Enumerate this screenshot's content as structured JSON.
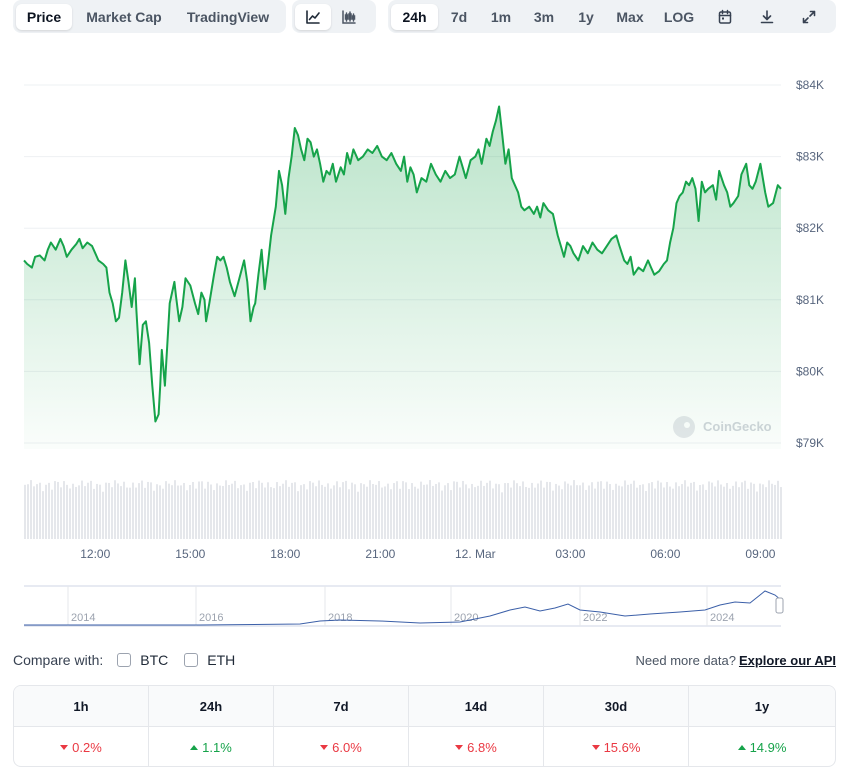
{
  "toolbar": {
    "metric_tabs": [
      {
        "label": "Price",
        "active": true
      },
      {
        "label": "Market Cap",
        "active": false
      },
      {
        "label": "TradingView",
        "active": false
      }
    ],
    "chart_type_icons": [
      {
        "name": "line-chart-icon",
        "active": true
      },
      {
        "name": "candlestick-chart-icon",
        "active": false
      }
    ],
    "ranges": [
      {
        "label": "24h",
        "active": true
      },
      {
        "label": "7d",
        "active": false
      },
      {
        "label": "1m",
        "active": false
      },
      {
        "label": "3m",
        "active": false
      },
      {
        "label": "1y",
        "active": false
      },
      {
        "label": "Max",
        "active": false
      },
      {
        "label": "LOG",
        "active": false
      }
    ],
    "action_icons": [
      "calendar-icon",
      "download-icon",
      "expand-icon"
    ]
  },
  "chart_data": {
    "type": "area",
    "title": "",
    "xlabel": "",
    "ylabel": "",
    "line_color": "#16a34a",
    "y_ticks": [
      "$79K",
      "$80K",
      "$81K",
      "$82K",
      "$83K",
      "$84K"
    ],
    "ylim": [
      79000,
      84000
    ],
    "x_ticks": [
      "12:00",
      "15:00",
      "18:00",
      "21:00",
      "12. Mar",
      "03:00",
      "06:00",
      "09:00"
    ],
    "x_tick_hours": [
      2,
      5,
      8,
      11,
      14,
      17,
      20,
      23
    ],
    "xlim_hours": [
      -0.25,
      23.65
    ],
    "grid": true,
    "watermark": "CoinGecko",
    "points": [
      [
        -0.25,
        81550
      ],
      [
        -0.15,
        81500
      ],
      [
        0.0,
        81450
      ],
      [
        0.1,
        81600
      ],
      [
        0.25,
        81620
      ],
      [
        0.4,
        81550
      ],
      [
        0.5,
        81700
      ],
      [
        0.6,
        81800
      ],
      [
        0.75,
        81700
      ],
      [
        0.9,
        81850
      ],
      [
        1.0,
        81750
      ],
      [
        1.1,
        81600
      ],
      [
        1.25,
        81700
      ],
      [
        1.4,
        81780
      ],
      [
        1.5,
        81850
      ],
      [
        1.6,
        81720
      ],
      [
        1.75,
        81800
      ],
      [
        1.9,
        81750
      ],
      [
        2.0,
        81650
      ],
      [
        2.1,
        81550
      ],
      [
        2.25,
        81500
      ],
      [
        2.35,
        81450
      ],
      [
        2.45,
        81100
      ],
      [
        2.55,
        80950
      ],
      [
        2.65,
        80700
      ],
      [
        2.75,
        80750
      ],
      [
        2.85,
        81100
      ],
      [
        2.95,
        81550
      ],
      [
        3.05,
        81250
      ],
      [
        3.15,
        80900
      ],
      [
        3.25,
        81300
      ],
      [
        3.3,
        80850
      ],
      [
        3.4,
        80100
      ],
      [
        3.5,
        80650
      ],
      [
        3.6,
        80700
      ],
      [
        3.7,
        80400
      ],
      [
        3.8,
        79800
      ],
      [
        3.9,
        79300
      ],
      [
        4.0,
        79400
      ],
      [
        4.05,
        79800
      ],
      [
        4.1,
        80300
      ],
      [
        4.2,
        79800
      ],
      [
        4.35,
        80950
      ],
      [
        4.5,
        81250
      ],
      [
        4.55,
        81050
      ],
      [
        4.65,
        80700
      ],
      [
        4.75,
        80900
      ],
      [
        4.85,
        81300
      ],
      [
        5.0,
        81200
      ],
      [
        5.15,
        80950
      ],
      [
        5.25,
        80800
      ],
      [
        5.35,
        81100
      ],
      [
        5.45,
        81000
      ],
      [
        5.5,
        80700
      ],
      [
        5.6,
        80950
      ],
      [
        5.75,
        81350
      ],
      [
        5.85,
        81600
      ],
      [
        5.95,
        81550
      ],
      [
        6.05,
        81600
      ],
      [
        6.15,
        81450
      ],
      [
        6.25,
        81250
      ],
      [
        6.4,
        81050
      ],
      [
        6.55,
        81300
      ],
      [
        6.7,
        81550
      ],
      [
        6.8,
        81250
      ],
      [
        6.9,
        80700
      ],
      [
        7.0,
        80900
      ],
      [
        7.05,
        80950
      ],
      [
        7.15,
        81350
      ],
      [
        7.25,
        81700
      ],
      [
        7.35,
        81150
      ],
      [
        7.45,
        81500
      ],
      [
        7.55,
        81900
      ],
      [
        7.7,
        82300
      ],
      [
        7.8,
        82800
      ],
      [
        7.9,
        82600
      ],
      [
        8.0,
        82200
      ],
      [
        8.1,
        82700
      ],
      [
        8.2,
        83000
      ],
      [
        8.3,
        83400
      ],
      [
        8.4,
        83300
      ],
      [
        8.5,
        83100
      ],
      [
        8.6,
        82950
      ],
      [
        8.7,
        83250
      ],
      [
        8.8,
        83200
      ],
      [
        8.9,
        83000
      ],
      [
        9.0,
        83100
      ],
      [
        9.1,
        82900
      ],
      [
        9.2,
        82650
      ],
      [
        9.3,
        82800
      ],
      [
        9.4,
        82750
      ],
      [
        9.5,
        82900
      ],
      [
        9.6,
        82650
      ],
      [
        9.75,
        82850
      ],
      [
        9.85,
        82750
      ],
      [
        9.95,
        83050
      ],
      [
        10.05,
        82900
      ],
      [
        10.15,
        83100
      ],
      [
        10.3,
        82950
      ],
      [
        10.45,
        83000
      ],
      [
        10.6,
        83100
      ],
      [
        10.75,
        83050
      ],
      [
        10.9,
        83150
      ],
      [
        11.05,
        83000
      ],
      [
        11.2,
        82950
      ],
      [
        11.35,
        83050
      ],
      [
        11.5,
        82900
      ],
      [
        11.65,
        82800
      ],
      [
        11.75,
        83000
      ],
      [
        11.85,
        82650
      ],
      [
        11.95,
        82850
      ],
      [
        12.05,
        82750
      ],
      [
        12.15,
        82500
      ],
      [
        12.3,
        82700
      ],
      [
        12.45,
        82650
      ],
      [
        12.6,
        82900
      ],
      [
        12.75,
        82750
      ],
      [
        12.9,
        82650
      ],
      [
        13.05,
        82800
      ],
      [
        13.2,
        82700
      ],
      [
        13.35,
        82750
      ],
      [
        13.5,
        83000
      ],
      [
        13.6,
        82850
      ],
      [
        13.7,
        82700
      ],
      [
        13.85,
        82950
      ],
      [
        14.0,
        83000
      ],
      [
        14.1,
        83100
      ],
      [
        14.2,
        82900
      ],
      [
        14.35,
        83250
      ],
      [
        14.45,
        83150
      ],
      [
        14.55,
        83350
      ],
      [
        14.65,
        83500
      ],
      [
        14.75,
        83700
      ],
      [
        14.85,
        83300
      ],
      [
        14.95,
        82900
      ],
      [
        15.05,
        83100
      ],
      [
        15.15,
        82700
      ],
      [
        15.25,
        82600
      ],
      [
        15.35,
        82500
      ],
      [
        15.45,
        82300
      ],
      [
        15.55,
        82250
      ],
      [
        15.7,
        82300
      ],
      [
        15.85,
        82200
      ],
      [
        15.95,
        82300
      ],
      [
        16.05,
        82150
      ],
      [
        16.15,
        82350
      ],
      [
        16.3,
        82250
      ],
      [
        16.45,
        82200
      ],
      [
        16.6,
        81900
      ],
      [
        16.7,
        81750
      ],
      [
        16.8,
        81600
      ],
      [
        16.9,
        81800
      ],
      [
        17.0,
        81750
      ],
      [
        17.1,
        81650
      ],
      [
        17.25,
        81550
      ],
      [
        17.4,
        81750
      ],
      [
        17.55,
        81650
      ],
      [
        17.7,
        81800
      ],
      [
        17.85,
        81700
      ],
      [
        18.0,
        81650
      ],
      [
        18.15,
        81750
      ],
      [
        18.3,
        81850
      ],
      [
        18.45,
        81900
      ],
      [
        18.55,
        81750
      ],
      [
        18.7,
        81550
      ],
      [
        18.8,
        81500
      ],
      [
        18.9,
        81600
      ],
      [
        19.0,
        81350
      ],
      [
        19.15,
        81450
      ],
      [
        19.3,
        81400
      ],
      [
        19.45,
        81550
      ],
      [
        19.55,
        81450
      ],
      [
        19.65,
        81350
      ],
      [
        19.8,
        81400
      ],
      [
        19.95,
        81500
      ],
      [
        20.05,
        81550
      ],
      [
        20.15,
        81800
      ],
      [
        20.25,
        82000
      ],
      [
        20.35,
        82350
      ],
      [
        20.45,
        82450
      ],
      [
        20.55,
        82500
      ],
      [
        20.65,
        82650
      ],
      [
        20.75,
        82600
      ],
      [
        20.85,
        82700
      ],
      [
        20.95,
        82550
      ],
      [
        21.05,
        82100
      ],
      [
        21.15,
        82650
      ],
      [
        21.25,
        82500
      ],
      [
        21.35,
        82550
      ],
      [
        21.5,
        82600
      ],
      [
        21.6,
        82400
      ],
      [
        21.7,
        82800
      ],
      [
        21.85,
        82600
      ],
      [
        21.95,
        82500
      ],
      [
        22.05,
        82300
      ],
      [
        22.15,
        82350
      ],
      [
        22.3,
        82450
      ],
      [
        22.4,
        82750
      ],
      [
        22.55,
        82900
      ],
      [
        22.65,
        82600
      ],
      [
        22.75,
        82550
      ],
      [
        22.85,
        82650
      ],
      [
        23.0,
        82900
      ],
      [
        23.15,
        82500
      ],
      [
        23.25,
        82300
      ],
      [
        23.4,
        82350
      ],
      [
        23.55,
        82600
      ],
      [
        23.65,
        82550
      ]
    ]
  },
  "overview": {
    "year_labels": [
      "2014",
      "2016",
      "2018",
      "2020",
      "2022",
      "2024"
    ],
    "line_color": "#3b5fa8"
  },
  "compare": {
    "label": "Compare with:",
    "options": [
      "BTC",
      "ETH"
    ],
    "more_text": "Need more data?",
    "more_link": "Explore our API"
  },
  "performance": {
    "headers": [
      "1h",
      "24h",
      "7d",
      "14d",
      "30d",
      "1y"
    ],
    "values": [
      {
        "text": "0.2%",
        "direction": "down"
      },
      {
        "text": "1.1%",
        "direction": "up"
      },
      {
        "text": "6.0%",
        "direction": "down"
      },
      {
        "text": "6.8%",
        "direction": "down"
      },
      {
        "text": "15.6%",
        "direction": "down"
      },
      {
        "text": "14.9%",
        "direction": "up"
      }
    ]
  }
}
